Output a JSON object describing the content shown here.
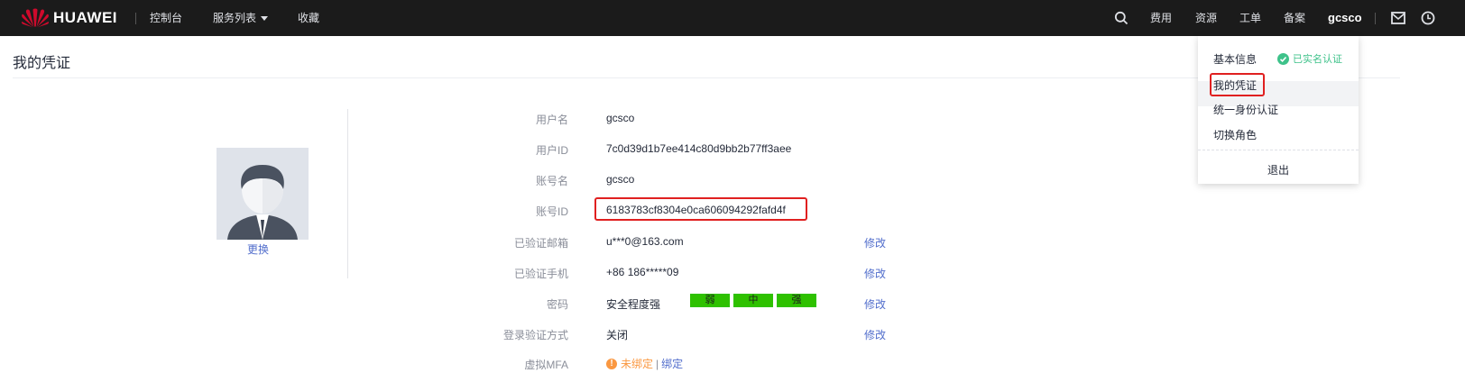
{
  "topbar": {
    "brand": "HUAWEI",
    "nav": {
      "console": "控制台",
      "services": "服务列表",
      "favorites": "收藏"
    },
    "right": {
      "billing": "费用",
      "resources": "资源",
      "tickets": "工单",
      "icp": "备案",
      "username": "gcsco"
    },
    "icons": [
      "search-icon",
      "mail-icon",
      "clock-icon",
      "chevron-down-icon"
    ],
    "colors": {
      "bar": "#1b1b1b",
      "logo_red": "#cf0a2c"
    }
  },
  "page": {
    "title": "我的凭证"
  },
  "profile": {
    "change_avatar": "更换",
    "rows": {
      "username": {
        "label": "用户名",
        "value": "gcsco"
      },
      "user_id": {
        "label": "用户ID",
        "value": "7c0d39d1b7ee414c80d9bb2b77ff3aee"
      },
      "account_name": {
        "label": "账号名",
        "value": "gcsco"
      },
      "account_id": {
        "label": "账号ID",
        "value": "6183783cf8304e0ca606094292fafd4f"
      },
      "email": {
        "label": "已验证邮箱",
        "value": "u***0@163.com",
        "action": "修改"
      },
      "phone": {
        "label": "已验证手机",
        "value": "+86 186*****09",
        "action": "修改"
      },
      "password": {
        "label": "密码",
        "value": "安全程度强",
        "strength_levels": [
          "弱",
          "中",
          "强"
        ],
        "action": "修改"
      },
      "login_verification": {
        "label": "登录验证方式",
        "value": "关闭",
        "action": "修改"
      },
      "virtual_mfa": {
        "label": "虚拟MFA",
        "status": "未绑定",
        "separator": "|",
        "action": "绑定"
      }
    },
    "colors": {
      "link": "#526ecc",
      "strength": "#2ec100",
      "warning": "#fa9841",
      "highlight": "#e02020"
    }
  },
  "dropdown": {
    "basic_info": "基本信息",
    "verified_badge": "已实名认证",
    "my_credentials": "我的凭证",
    "unified_identity": "统一身份认证",
    "switch_role": "切换角色",
    "logout": "退出",
    "colors": {
      "verified": "#3ec28a"
    }
  }
}
